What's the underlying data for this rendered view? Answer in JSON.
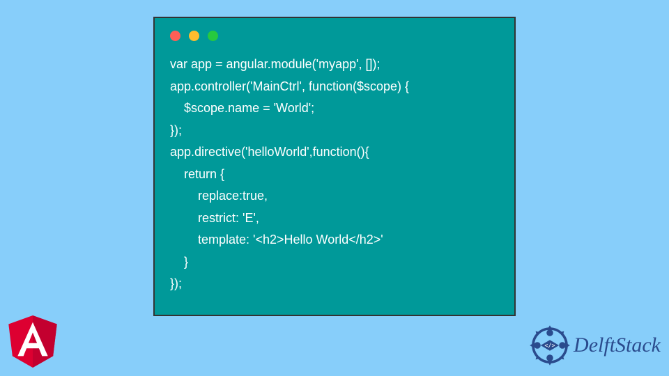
{
  "code_window": {
    "lines": "var app = angular.module('myapp', []);\napp.controller('MainCtrl', function($scope) {\n    $scope.name = 'World';\n});\napp.directive('helloWorld',function(){\n    return {\n        replace:true,\n        restrict: 'E',\n        template: '<h2>Hello World</h2>'\n    }\n});"
  },
  "angular_logo": {
    "letter": "A"
  },
  "delftstack": {
    "label": "DelftStack"
  },
  "colors": {
    "background": "#87cefa",
    "window_bg": "#009999",
    "window_border": "#333333",
    "code_text": "#ffffff",
    "angular_red": "#dd0031",
    "angular_dark": "#c3002f",
    "delft_blue": "#2a4b8d"
  }
}
